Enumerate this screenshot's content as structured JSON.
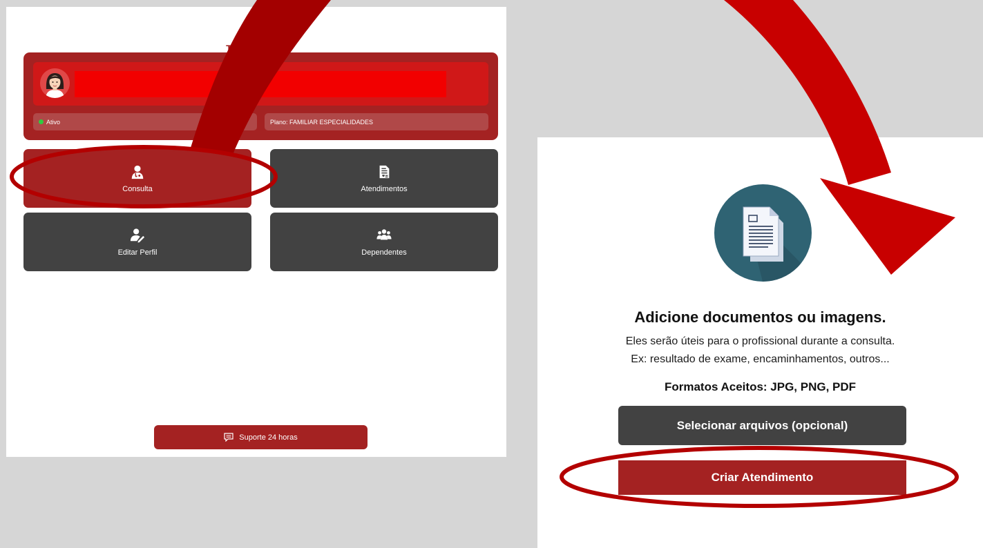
{
  "left_screen": {
    "title": "Telemedicina",
    "status": {
      "label": "Ativo",
      "color": "#2ecc40"
    },
    "plan": "Plano: FAMILIAR ESPECIALIDADES",
    "tiles": [
      {
        "label": "Consulta",
        "icon": "doctor-icon",
        "active": true
      },
      {
        "label": "Atendimentos",
        "icon": "medical-document-icon",
        "active": false
      },
      {
        "label": "Editar Perfil",
        "icon": "edit-user-icon",
        "active": false
      },
      {
        "label": "Dependentes",
        "icon": "group-icon",
        "active": false
      }
    ],
    "support_label": "Suporte 24 horas",
    "support_icon": "chat-icon"
  },
  "right_screen": {
    "icon": "documents-icon",
    "title": "Adicione documentos ou imagens.",
    "line1": "Eles serão úteis para o profissional durante a consulta.",
    "line2": "Ex: resultado de exame, encaminhamentos, outros...",
    "formats": "Formatos Aceitos: JPG, PNG, PDF",
    "select_label": "Selecionar arquivos (opcional)",
    "create_label": "Criar Atendimento"
  },
  "colors": {
    "brand_red": "#a42222",
    "dark_gray": "#424242",
    "annotation_red": "#c00000",
    "redaction": "#f20000"
  }
}
